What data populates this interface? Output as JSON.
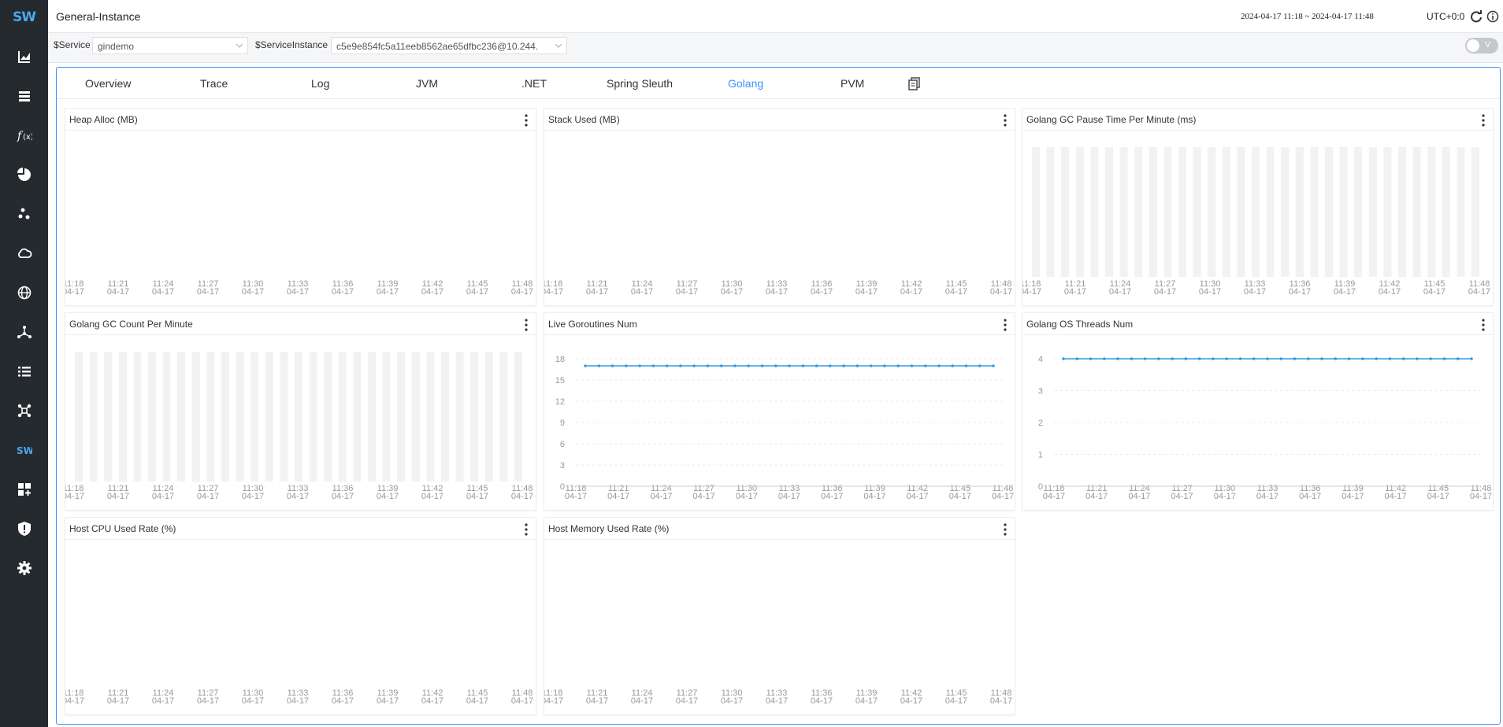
{
  "app": {
    "title": "General-Instance",
    "time_range": "2024-04-17 11:18 ~ 2024-04-17 11:48",
    "timezone": "UTC+0:0",
    "logo_text": "SW"
  },
  "sidebar": {
    "items": [
      {
        "icon": "chart-icon"
      },
      {
        "icon": "database-icon"
      },
      {
        "icon": "function-icon"
      },
      {
        "icon": "pie-icon"
      },
      {
        "icon": "dots-icon"
      },
      {
        "icon": "cloud-icon"
      },
      {
        "icon": "globe-icon"
      },
      {
        "icon": "mesh-icon"
      },
      {
        "icon": "list-icon"
      },
      {
        "icon": "network-icon"
      },
      {
        "icon": "skywalking-icon"
      },
      {
        "icon": "dashboard-add-icon"
      },
      {
        "icon": "alert-icon"
      },
      {
        "icon": "settings-icon"
      }
    ]
  },
  "selectors": {
    "service_label": "$Service",
    "service_value": "gindemo",
    "instance_label": "$ServiceInstance",
    "instance_value": "c5e9e854fc5a11eeb8562ae65dfbc236@10.244.",
    "toggle_label": "V"
  },
  "tabs": [
    {
      "label": "Overview",
      "active": false
    },
    {
      "label": "Trace",
      "active": false
    },
    {
      "label": "Log",
      "active": false
    },
    {
      "label": "JVM",
      "active": false
    },
    {
      "label": ".NET",
      "active": false
    },
    {
      "label": "Spring Sleuth",
      "active": false
    },
    {
      "label": "Golang",
      "active": true
    },
    {
      "label": "PVM",
      "active": false
    }
  ],
  "colors": {
    "accent": "#3d92ff",
    "line": "#3a9bdc",
    "bar": "#f2f2f2",
    "sidebar": "#252a2f"
  },
  "time_ticks": [
    "11:18",
    "11:21",
    "11:24",
    "11:27",
    "11:30",
    "11:33",
    "11:36",
    "11:39",
    "11:42",
    "11:45",
    "11:48"
  ],
  "date_tick": "04-17",
  "chart_data": [
    {
      "type": "line",
      "title": "Heap Alloc (MB)",
      "x": [
        "11:18",
        "11:21",
        "11:24",
        "11:27",
        "11:30",
        "11:33",
        "11:36",
        "11:39",
        "11:42",
        "11:45",
        "11:48"
      ],
      "series": [],
      "clipped_left": true
    },
    {
      "type": "line",
      "title": "Stack Used (MB)",
      "x": [
        "11:18",
        "11:21",
        "11:24",
        "11:27",
        "11:30",
        "11:33",
        "11:36",
        "11:39",
        "11:42",
        "11:45",
        "11:48"
      ],
      "series": [],
      "clipped_left": true
    },
    {
      "type": "bar",
      "title": "Golang GC Pause Time Per Minute (ms)",
      "x": [
        "11:18",
        "11:21",
        "11:24",
        "11:27",
        "11:30",
        "11:33",
        "11:36",
        "11:39",
        "11:42",
        "11:45",
        "11:48"
      ],
      "bar_count": 31,
      "series": [],
      "clipped_left": true
    },
    {
      "type": "bar",
      "title": "Golang GC Count Per Minute",
      "x": [
        "11:18",
        "11:21",
        "11:24",
        "11:27",
        "11:30",
        "11:33",
        "11:36",
        "11:39",
        "11:42",
        "11:45",
        "11:48"
      ],
      "bar_count": 31,
      "series": [],
      "clipped_left": true
    },
    {
      "type": "line",
      "title": "Live Goroutines Num",
      "x": [
        "11:18",
        "11:21",
        "11:24",
        "11:27",
        "11:30",
        "11:33",
        "11:36",
        "11:39",
        "11:42",
        "11:45",
        "11:48"
      ],
      "yticks": [
        0,
        3,
        6,
        9,
        12,
        15,
        18
      ],
      "ylim": [
        0,
        18
      ],
      "points": 31,
      "series": [
        {
          "values": [
            17,
            17,
            17,
            17,
            17,
            17,
            17,
            17,
            17,
            17,
            17,
            17,
            17,
            17,
            17,
            17,
            17,
            17,
            17,
            17,
            17,
            17,
            17,
            17,
            17,
            17,
            17,
            17,
            17,
            17,
            17
          ]
        }
      ]
    },
    {
      "type": "line",
      "title": "Golang OS Threads Num",
      "x": [
        "11:18",
        "11:21",
        "11:24",
        "11:27",
        "11:30",
        "11:33",
        "11:36",
        "11:39",
        "11:42",
        "11:45",
        "11:48"
      ],
      "yticks": [
        0,
        1,
        2,
        3,
        4
      ],
      "ylim": [
        0,
        4
      ],
      "points": 31,
      "series": [
        {
          "values": [
            4,
            4,
            4,
            4,
            4,
            4,
            4,
            4,
            4,
            4,
            4,
            4,
            4,
            4,
            4,
            4,
            4,
            4,
            4,
            4,
            4,
            4,
            4,
            4,
            4,
            4,
            4,
            4,
            4,
            4,
            4
          ]
        }
      ]
    },
    {
      "type": "line",
      "title": "Host CPU Used Rate (%)",
      "x": [
        "11:18",
        "11:21",
        "11:24",
        "11:27",
        "11:30",
        "11:33",
        "11:36",
        "11:39",
        "11:42",
        "11:45",
        "11:48"
      ],
      "series": [],
      "clipped_left": true
    },
    {
      "type": "line",
      "title": "Host Memory Used Rate (%)",
      "x": [
        "11:18",
        "11:21",
        "11:24",
        "11:27",
        "11:30",
        "11:33",
        "11:36",
        "11:39",
        "11:42",
        "11:45",
        "11:48"
      ],
      "series": [],
      "clipped_left": true
    }
  ]
}
